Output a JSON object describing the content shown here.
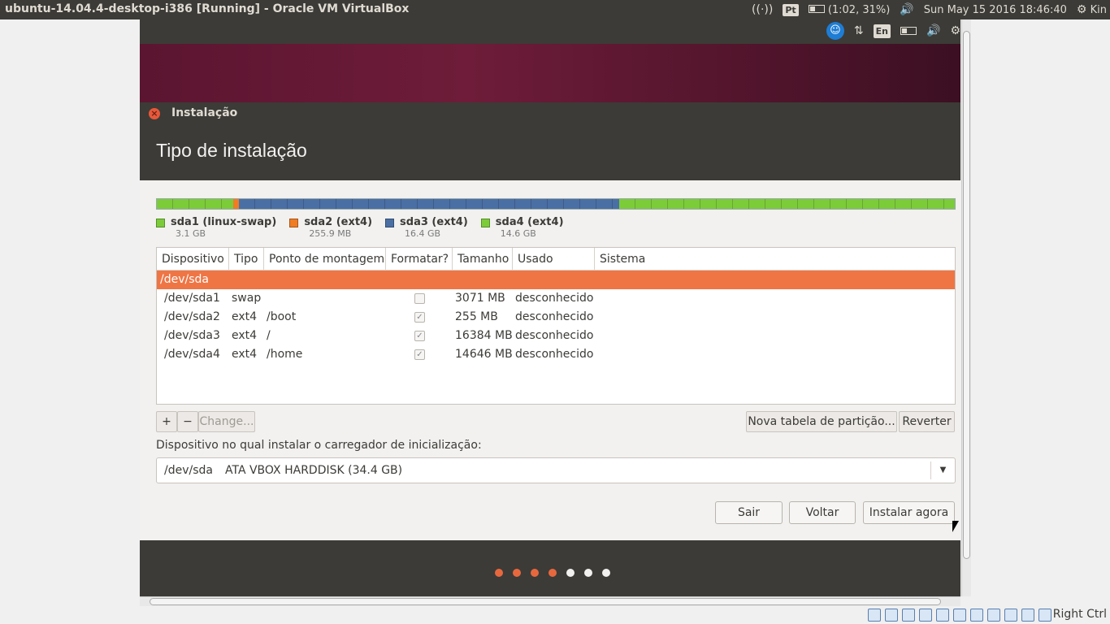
{
  "host": {
    "title": "ubuntu-14.04.4-desktop-i386 [Running] - Oracle VM VirtualBox",
    "lang": "Pt",
    "battery": "(1:02, 31%)",
    "datetime": "Sun May 15 2016 18:46:40",
    "user": "Kin"
  },
  "guest_panel": {
    "lang": "En"
  },
  "window": {
    "title": "Instalação",
    "heading": "Tipo de instalação"
  },
  "partitions": {
    "bar": [
      {
        "name": "sda1",
        "fraction": 0.0956,
        "color": "#7ccc3a"
      },
      {
        "name": "sda2",
        "fraction": 0.0074,
        "color": "#f07c24"
      },
      {
        "name": "sda3",
        "fraction": 0.4764,
        "color": "#4a6fa5"
      },
      {
        "name": "sda4",
        "fraction": 0.4206,
        "color": "#7ccc3a"
      }
    ],
    "legend": [
      {
        "name": "sda1 (linux-swap)",
        "size": "3.1 GB",
        "color": "#7ccc3a"
      },
      {
        "name": "sda2 (ext4)",
        "size": "255.9 MB",
        "color": "#f07c24"
      },
      {
        "name": "sda3 (ext4)",
        "size": "16.4 GB",
        "color": "#4a6fa5"
      },
      {
        "name": "sda4 (ext4)",
        "size": "14.6 GB",
        "color": "#7ccc3a"
      }
    ]
  },
  "table": {
    "columns": [
      "Dispositivo",
      "Tipo",
      "Ponto de montagem",
      "Formatar?",
      "Tamanho",
      "Usado",
      "Sistema"
    ],
    "disk": "/dev/sda",
    "rows": [
      {
        "device": "/dev/sda1",
        "type": "swap",
        "mount": "",
        "format": false,
        "size": "3071 MB",
        "used": "desconhecido"
      },
      {
        "device": "/dev/sda2",
        "type": "ext4",
        "mount": "/boot",
        "format": true,
        "size": "255 MB",
        "used": "desconhecido"
      },
      {
        "device": "/dev/sda3",
        "type": "ext4",
        "mount": "/",
        "format": true,
        "size": "16384 MB",
        "used": "desconhecido"
      },
      {
        "device": "/dev/sda4",
        "type": "ext4",
        "mount": "/home",
        "format": true,
        "size": "14646 MB",
        "used": "desconhecido"
      }
    ]
  },
  "toolbar": {
    "add": "+",
    "remove": "−",
    "change": "Change...",
    "new_table": "Nova tabela de partição...",
    "revert": "Reverter"
  },
  "bootloader": {
    "label": "Dispositivo no qual instalar o carregador de inicialização:",
    "device": "/dev/sda",
    "description": "ATA VBOX HARDDISK (34.4 GB)"
  },
  "buttons": {
    "quit": "Sair",
    "back": "Voltar",
    "install": "Instalar agora"
  },
  "progress": {
    "total_steps": 7,
    "current_step": 4
  },
  "statusbar": {
    "host_key": "Right Ctrl"
  },
  "colors": {
    "accent": "#ef7545",
    "panel": "#3c3b37"
  }
}
